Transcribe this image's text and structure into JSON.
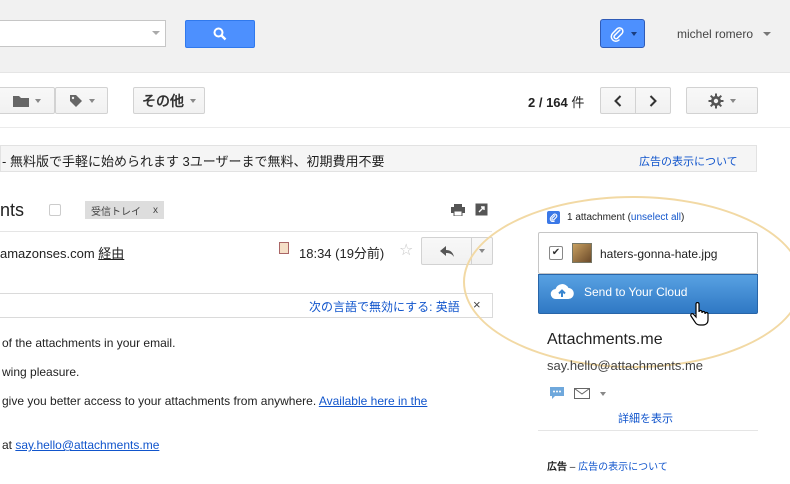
{
  "header": {
    "search_placeholder": "",
    "user_name": "michel romero"
  },
  "toolbar": {
    "other_label": "その他",
    "pager_range": "2",
    "pager_sep": " / ",
    "pager_total": "164",
    "pager_unit": " 件"
  },
  "adbar": {
    "text": "- 無料版で手軽に始められます 3ユーザーまで無料、初期費用不要",
    "link": "広告の表示について"
  },
  "message": {
    "subject": "nts",
    "label": "受信トレイ",
    "label_close": "x",
    "sender_prefix": "amazonses.com ",
    "sender_via": "経由",
    "time": "18:34 (19分前)",
    "star": "☆"
  },
  "translate": {
    "text": "次の言語で無効にする: 英語",
    "close": "×"
  },
  "body": {
    "line1": "of the attachments in your email.",
    "line2": "wing pleasure.",
    "line3_text": "give you better access to your attachments from anywhere. ",
    "line3_link": "Available here in the",
    "line4_prefix": "at ",
    "line4_link": "say.hello@attachments.me"
  },
  "sidebar": {
    "attach_count": "1 attachment",
    "unselect_open": " (",
    "unselect_link": "unselect all",
    "unselect_close": ")",
    "file_name": "haters-gonna-hate.jpg",
    "checkmark": "✔",
    "send_label": "Send to Your Cloud",
    "title": "Attachments.me",
    "email": "say.hello@attachments.me",
    "details_link": "詳細を表示",
    "ad_label": "広告",
    "ad_sep": " – ",
    "ad_link": "広告の表示について"
  },
  "colors": {
    "accent_blue": "#4d90fe",
    "link": "#1155cc",
    "send_button": "#3a86d0",
    "highlight_ring": "#f2d9a4"
  },
  "icons": [
    "search-icon",
    "paperclip-icon",
    "folder-icon",
    "label-icon",
    "gear-icon",
    "chevron-left-icon",
    "chevron-right-icon",
    "print-icon",
    "new-window-icon",
    "reply-icon",
    "cloud-icon",
    "hand-cursor-icon",
    "chat-icon",
    "mail-icon"
  ]
}
